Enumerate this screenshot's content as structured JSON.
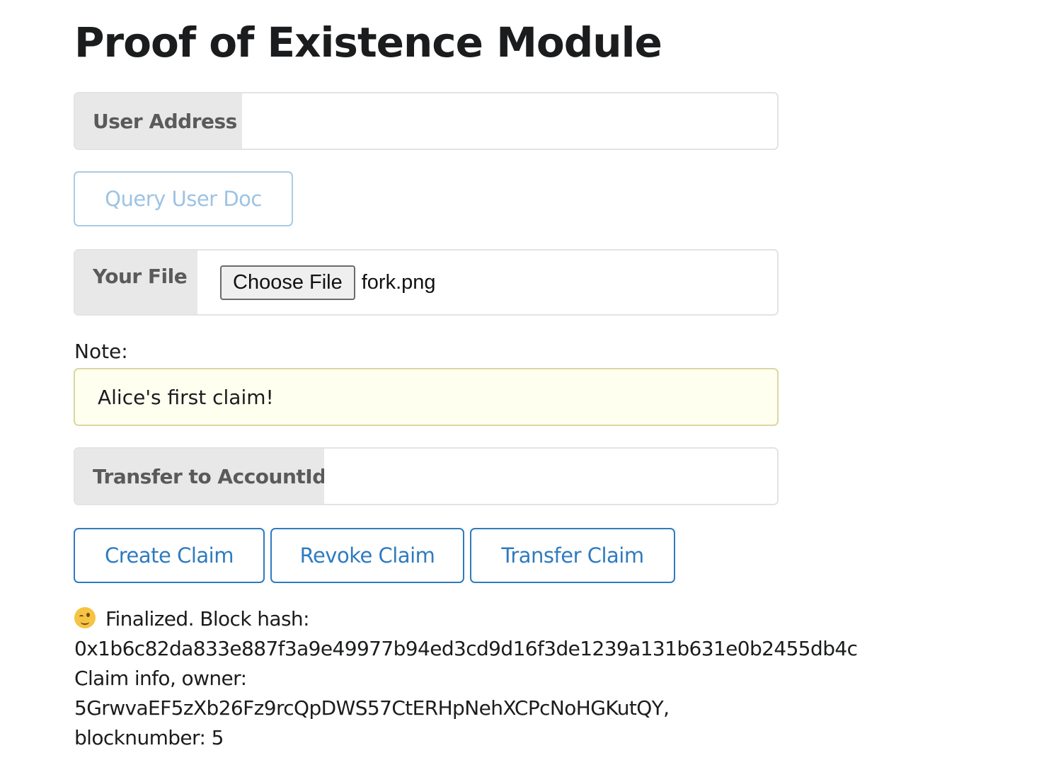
{
  "page": {
    "title": "Proof of Existence Module"
  },
  "user_address": {
    "label": "User Address",
    "value": ""
  },
  "query_button": {
    "label": "Query User Doc"
  },
  "file": {
    "label": "Your File",
    "button_label": "Choose File",
    "file_name": "fork.png"
  },
  "note": {
    "label": "Note:",
    "value": "Alice's first claim!"
  },
  "transfer": {
    "label": "Transfer to AccountId",
    "value": ""
  },
  "actions": {
    "create_label": "Create Claim",
    "revoke_label": "Revoke Claim",
    "transfer_label": "Transfer Claim"
  },
  "status": {
    "icon": "winking-face-icon",
    "line1": "Finalized. Block hash:",
    "line2": "0x1b6c82da833e887f3a9e49977b94ed3cd9d16f3de1239a131b631e0b2455db4c",
    "line3": "Claim info, owner:",
    "line4": "5GrwvaEF5zXb26Fz9rcQpDWS57CtERHpNehXCPcNoHGKutQY,",
    "line5": "blocknumber: 5"
  },
  "colors": {
    "primary": "#2f7bbf",
    "disabled_button": "#9ec3e3",
    "label_bg": "#e8e8e8",
    "note_bg": "#fffff0"
  }
}
